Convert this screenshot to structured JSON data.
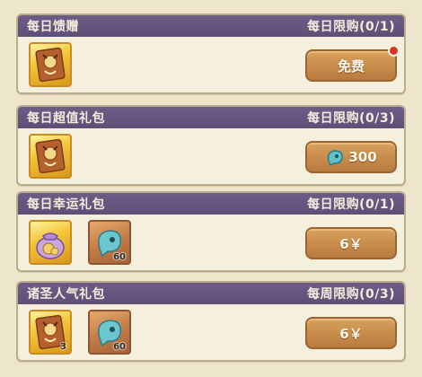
{
  "panels": [
    {
      "title": "每日馈赠",
      "limit": "每日限购(0/1)",
      "button": {
        "label": "免费",
        "has_red_dot": true
      },
      "items": [
        {
          "type": "gold-card",
          "count": ""
        }
      ]
    },
    {
      "title": "每日超值礼包",
      "limit": "每日限购(0/3)",
      "button": {
        "label": "300",
        "currency_icon": "soul-gem-icon"
      },
      "items": [
        {
          "type": "gold-card",
          "count": ""
        }
      ]
    },
    {
      "title": "每日幸运礼包",
      "limit": "每日限购(0/1)",
      "button": {
        "label": "6￥"
      },
      "items": [
        {
          "type": "gold-pouch",
          "count": ""
        },
        {
          "type": "soul-gem",
          "count": "60"
        }
      ]
    },
    {
      "title": "诸圣人气礼包",
      "limit": "每周限购(0/3)",
      "button": {
        "label": "6￥"
      },
      "items": [
        {
          "type": "gold-card",
          "count": "3"
        },
        {
          "type": "soul-gem",
          "count": "60"
        }
      ]
    }
  ],
  "colors": {
    "header": "#5f4f77",
    "button": "#c68b4b",
    "red_dot": "#d9342b"
  }
}
